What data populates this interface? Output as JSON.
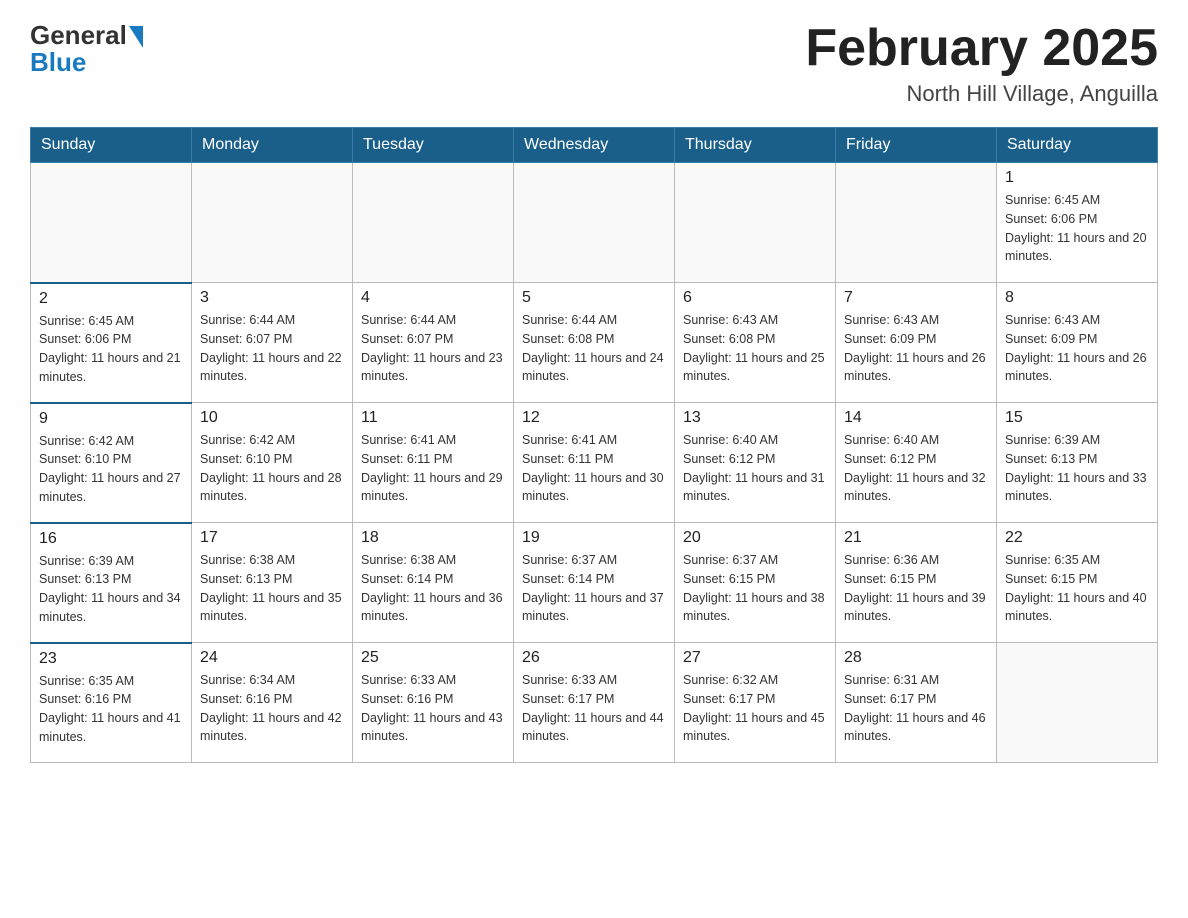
{
  "header": {
    "logo_general": "General",
    "logo_blue": "Blue",
    "month_title": "February 2025",
    "location": "North Hill Village, Anguilla"
  },
  "days_of_week": [
    "Sunday",
    "Monday",
    "Tuesday",
    "Wednesday",
    "Thursday",
    "Friday",
    "Saturday"
  ],
  "weeks": [
    [
      {
        "day": "",
        "info": ""
      },
      {
        "day": "",
        "info": ""
      },
      {
        "day": "",
        "info": ""
      },
      {
        "day": "",
        "info": ""
      },
      {
        "day": "",
        "info": ""
      },
      {
        "day": "",
        "info": ""
      },
      {
        "day": "1",
        "info": "Sunrise: 6:45 AM\nSunset: 6:06 PM\nDaylight: 11 hours and 20 minutes."
      }
    ],
    [
      {
        "day": "2",
        "info": "Sunrise: 6:45 AM\nSunset: 6:06 PM\nDaylight: 11 hours and 21 minutes."
      },
      {
        "day": "3",
        "info": "Sunrise: 6:44 AM\nSunset: 6:07 PM\nDaylight: 11 hours and 22 minutes."
      },
      {
        "day": "4",
        "info": "Sunrise: 6:44 AM\nSunset: 6:07 PM\nDaylight: 11 hours and 23 minutes."
      },
      {
        "day": "5",
        "info": "Sunrise: 6:44 AM\nSunset: 6:08 PM\nDaylight: 11 hours and 24 minutes."
      },
      {
        "day": "6",
        "info": "Sunrise: 6:43 AM\nSunset: 6:08 PM\nDaylight: 11 hours and 25 minutes."
      },
      {
        "day": "7",
        "info": "Sunrise: 6:43 AM\nSunset: 6:09 PM\nDaylight: 11 hours and 26 minutes."
      },
      {
        "day": "8",
        "info": "Sunrise: 6:43 AM\nSunset: 6:09 PM\nDaylight: 11 hours and 26 minutes."
      }
    ],
    [
      {
        "day": "9",
        "info": "Sunrise: 6:42 AM\nSunset: 6:10 PM\nDaylight: 11 hours and 27 minutes."
      },
      {
        "day": "10",
        "info": "Sunrise: 6:42 AM\nSunset: 6:10 PM\nDaylight: 11 hours and 28 minutes."
      },
      {
        "day": "11",
        "info": "Sunrise: 6:41 AM\nSunset: 6:11 PM\nDaylight: 11 hours and 29 minutes."
      },
      {
        "day": "12",
        "info": "Sunrise: 6:41 AM\nSunset: 6:11 PM\nDaylight: 11 hours and 30 minutes."
      },
      {
        "day": "13",
        "info": "Sunrise: 6:40 AM\nSunset: 6:12 PM\nDaylight: 11 hours and 31 minutes."
      },
      {
        "day": "14",
        "info": "Sunrise: 6:40 AM\nSunset: 6:12 PM\nDaylight: 11 hours and 32 minutes."
      },
      {
        "day": "15",
        "info": "Sunrise: 6:39 AM\nSunset: 6:13 PM\nDaylight: 11 hours and 33 minutes."
      }
    ],
    [
      {
        "day": "16",
        "info": "Sunrise: 6:39 AM\nSunset: 6:13 PM\nDaylight: 11 hours and 34 minutes."
      },
      {
        "day": "17",
        "info": "Sunrise: 6:38 AM\nSunset: 6:13 PM\nDaylight: 11 hours and 35 minutes."
      },
      {
        "day": "18",
        "info": "Sunrise: 6:38 AM\nSunset: 6:14 PM\nDaylight: 11 hours and 36 minutes."
      },
      {
        "day": "19",
        "info": "Sunrise: 6:37 AM\nSunset: 6:14 PM\nDaylight: 11 hours and 37 minutes."
      },
      {
        "day": "20",
        "info": "Sunrise: 6:37 AM\nSunset: 6:15 PM\nDaylight: 11 hours and 38 minutes."
      },
      {
        "day": "21",
        "info": "Sunrise: 6:36 AM\nSunset: 6:15 PM\nDaylight: 11 hours and 39 minutes."
      },
      {
        "day": "22",
        "info": "Sunrise: 6:35 AM\nSunset: 6:15 PM\nDaylight: 11 hours and 40 minutes."
      }
    ],
    [
      {
        "day": "23",
        "info": "Sunrise: 6:35 AM\nSunset: 6:16 PM\nDaylight: 11 hours and 41 minutes."
      },
      {
        "day": "24",
        "info": "Sunrise: 6:34 AM\nSunset: 6:16 PM\nDaylight: 11 hours and 42 minutes."
      },
      {
        "day": "25",
        "info": "Sunrise: 6:33 AM\nSunset: 6:16 PM\nDaylight: 11 hours and 43 minutes."
      },
      {
        "day": "26",
        "info": "Sunrise: 6:33 AM\nSunset: 6:17 PM\nDaylight: 11 hours and 44 minutes."
      },
      {
        "day": "27",
        "info": "Sunrise: 6:32 AM\nSunset: 6:17 PM\nDaylight: 11 hours and 45 minutes."
      },
      {
        "day": "28",
        "info": "Sunrise: 6:31 AM\nSunset: 6:17 PM\nDaylight: 11 hours and 46 minutes."
      },
      {
        "day": "",
        "info": ""
      }
    ]
  ]
}
